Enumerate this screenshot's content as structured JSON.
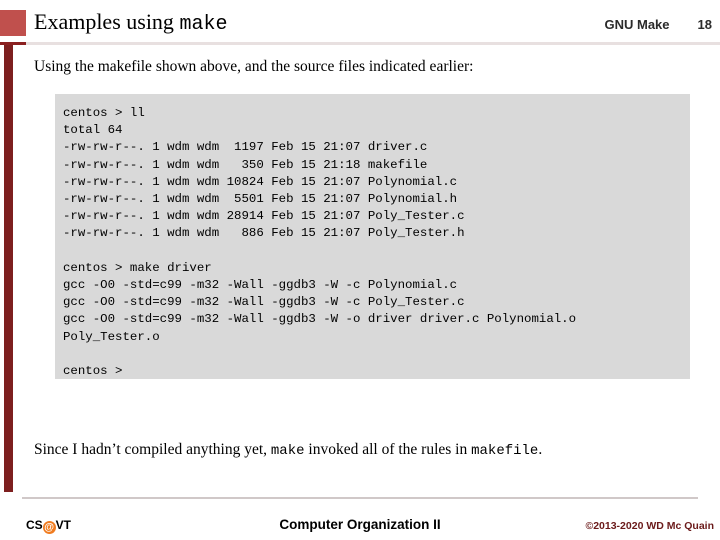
{
  "header": {
    "title_prefix": "Examples using ",
    "title_mono": "make",
    "course": "GNU Make",
    "page_number": "18"
  },
  "body": {
    "intro": "Using the makefile shown above, and the source files indicated earlier:",
    "code": "centos > ll\ntotal 64\n-rw-rw-r--. 1 wdm wdm  1197 Feb 15 21:07 driver.c\n-rw-rw-r--. 1 wdm wdm   350 Feb 15 21:18 makefile\n-rw-rw-r--. 1 wdm wdm 10824 Feb 15 21:07 Polynomial.c\n-rw-rw-r--. 1 wdm wdm  5501 Feb 15 21:07 Polynomial.h\n-rw-rw-r--. 1 wdm wdm 28914 Feb 15 21:07 Poly_Tester.c\n-rw-rw-r--. 1 wdm wdm   886 Feb 15 21:07 Poly_Tester.h\n\ncentos > make driver\ngcc -O0 -std=c99 -m32 -Wall -ggdb3 -W -c Polynomial.c\ngcc -O0 -std=c99 -m32 -Wall -ggdb3 -W -c Poly_Tester.c\ngcc -O0 -std=c99 -m32 -Wall -ggdb3 -W -o driver driver.c Polynomial.o\nPoly_Tester.o\n\ncentos > ",
    "closing_part1": "Since I hadn’t compiled anything yet, ",
    "closing_mono1": "make",
    "closing_part2": " invoked all of the rules in ",
    "closing_mono2": "makefile",
    "closing_part3": "."
  },
  "footer": {
    "logo_prefix": "CS",
    "logo_at": "@",
    "logo_suffix": "VT",
    "center": "Computer Organization II",
    "right": "©2013-2020 WD Mc Quain"
  },
  "colors": {
    "accent_square": "#c0504d",
    "left_bar": "#7d1f1f",
    "code_bg": "#d9d9d9",
    "footer_right": "#6b1a1a",
    "logo_at_bg": "#f07c20"
  }
}
